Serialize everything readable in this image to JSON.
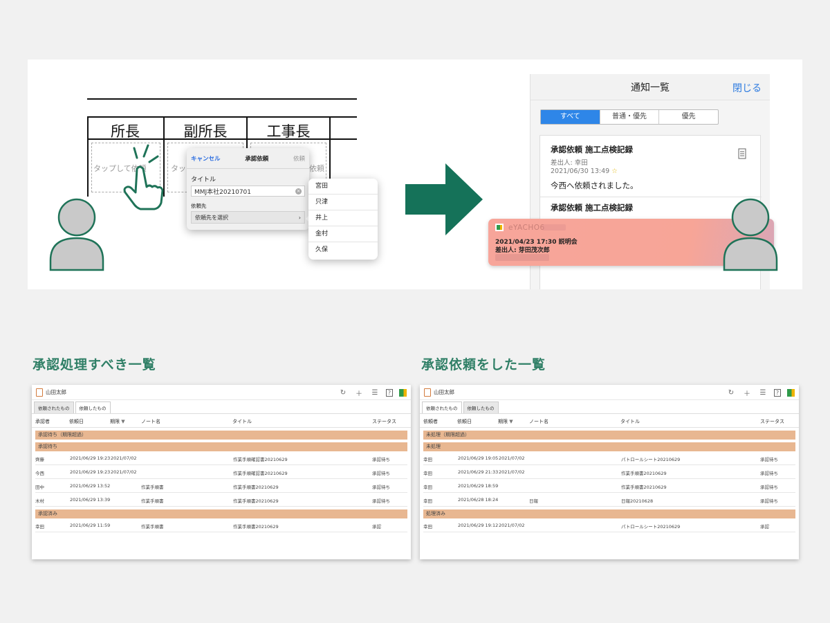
{
  "illustration": {
    "stamp_headers": [
      "所長",
      "副所長",
      "工事長"
    ],
    "stamp_placeholder": "タップして依頼",
    "dialog": {
      "cancel": "キャンセル",
      "title": "承認依頼",
      "ok": "依頼",
      "title_label": "タイトル",
      "title_value": "MMJ本社20210701",
      "dest_label": "依頼先",
      "dest_select": "依頼先を選択"
    },
    "popover_items": [
      "宮田",
      "只津",
      "井上",
      "金村",
      "久保"
    ],
    "notification": {
      "title": "通知一覧",
      "close": "閉じる",
      "segments": [
        "すべて",
        "普通・優先",
        "優先"
      ],
      "card1_title": "承認依頼 施工点検記録",
      "card1_from": "差出人: 幸田",
      "card1_date": "2021/06/30 13:49",
      "card1_msg": "今西へ依頼されました。",
      "card2_title": "承認依頼 施工点検記録"
    },
    "banner": {
      "app": "eYACHO6",
      "line1": "2021/04/23 17:30 説明会",
      "line2": "差出人: 芽田茂次郎"
    }
  },
  "left": {
    "section_title": "承認処理すべき一覧",
    "user": "山田太郎",
    "tabs": [
      "依頼されたもの",
      "依頼したもの"
    ],
    "columns": [
      "承認者",
      "依頼日",
      "期限",
      "ノート名",
      "タイトル",
      "ステータス"
    ],
    "groups": [
      {
        "label": "承認待ち（期限超過）",
        "rows": []
      },
      {
        "label": "承認待ち",
        "rows": [
          {
            "who": "齊藤",
            "date": "2021/06/29 19:23",
            "due": "2021/07/02",
            "note": "",
            "title": "作業手順確認書20210629",
            "status": "承認待ち"
          },
          {
            "who": "今西",
            "date": "2021/06/29 19:23",
            "due": "2021/07/02",
            "note": "",
            "title": "作業手順確認書20210629",
            "status": "承認待ち"
          },
          {
            "who": "田中",
            "date": "2021/06/29 13:52",
            "due": "",
            "note": "作業手順書",
            "title": "作業手順書20210629",
            "status": "承認待ち"
          },
          {
            "who": "木村",
            "date": "2021/06/29 13:39",
            "due": "",
            "note": "作業手順書",
            "title": "作業手順書20210629",
            "status": "承認待ち"
          }
        ]
      },
      {
        "label": "承認済み",
        "rows": [
          {
            "who": "幸田",
            "date": "2021/06/29 11:59",
            "due": "",
            "note": "作業手順書",
            "title": "作業手順書20210629",
            "status": "承認"
          }
        ]
      }
    ]
  },
  "right": {
    "section_title": "承認依頼をした一覧",
    "user": "山田太郎",
    "tabs": [
      "依頼されたもの",
      "依頼したもの"
    ],
    "columns": [
      "依頼者",
      "依頼日",
      "期限",
      "ノート名",
      "タイトル",
      "ステータス"
    ],
    "groups": [
      {
        "label": "未処理（期限超過）",
        "rows": []
      },
      {
        "label": "未処理",
        "rows": [
          {
            "who": "幸田",
            "date": "2021/06/29 19:05",
            "due": "2021/07/02",
            "note": "",
            "title": "パトロールシート20210629",
            "status": "承認待ち"
          },
          {
            "who": "幸田",
            "date": "2021/06/29 21:33",
            "due": "2021/07/02",
            "note": "",
            "title": "作業手順書20210629",
            "status": "承認待ち"
          },
          {
            "who": "幸田",
            "date": "2021/06/29 18:59",
            "due": "",
            "note": "",
            "title": "作業手順書20210629",
            "status": "承認待ち"
          },
          {
            "who": "幸田",
            "date": "2021/06/28 18:24",
            "due": "",
            "note": "日報",
            "title": "日報20210628",
            "status": "承認待ち"
          }
        ]
      },
      {
        "label": "処理済み",
        "rows": [
          {
            "who": "幸田",
            "date": "2021/06/29 19:12",
            "due": "2021/07/02",
            "note": "",
            "title": "パトロールシート20210629",
            "status": "承認"
          }
        ]
      }
    ]
  },
  "colors": {
    "green": "#2f7f66",
    "accent_blue": "#2e86e8",
    "group_bar": "#e8b791",
    "banner": "#f7a59a"
  }
}
